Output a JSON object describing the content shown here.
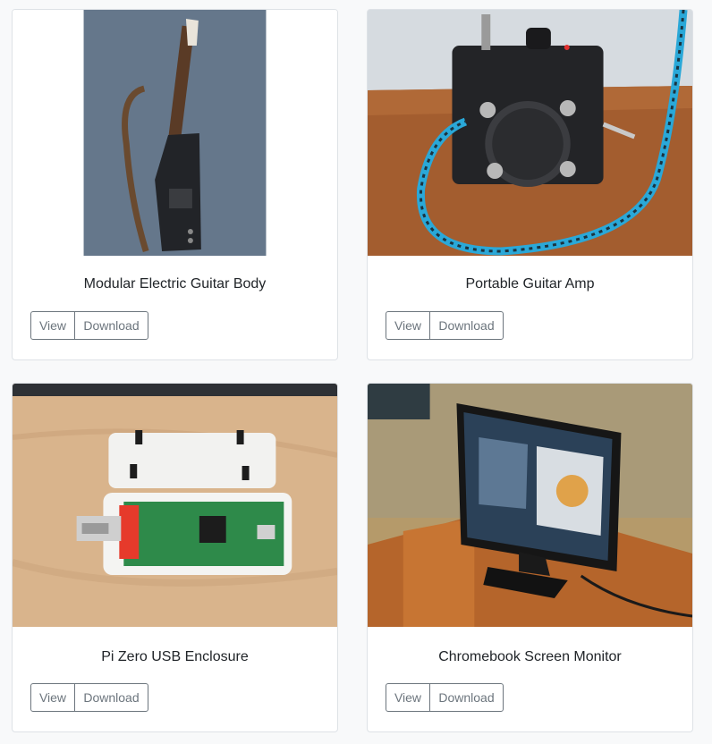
{
  "cards": [
    {
      "title": "Modular Electric Guitar Body",
      "view_label": "View",
      "download_label": "Download",
      "image": "guitar-body-photo"
    },
    {
      "title": "Portable Guitar Amp",
      "view_label": "View",
      "download_label": "Download",
      "image": "guitar-amp-photo"
    },
    {
      "title": "Pi Zero USB Enclosure",
      "view_label": "View",
      "download_label": "Download",
      "image": "pi-zero-enclosure-photo"
    },
    {
      "title": "Chromebook Screen Monitor",
      "view_label": "View",
      "download_label": "Download",
      "image": "monitor-photo"
    }
  ],
  "colors": {
    "page_bg": "#f8f9fa",
    "card_border": "#dee2e6",
    "button_outline": "#6c757d",
    "title_text": "#212529"
  }
}
